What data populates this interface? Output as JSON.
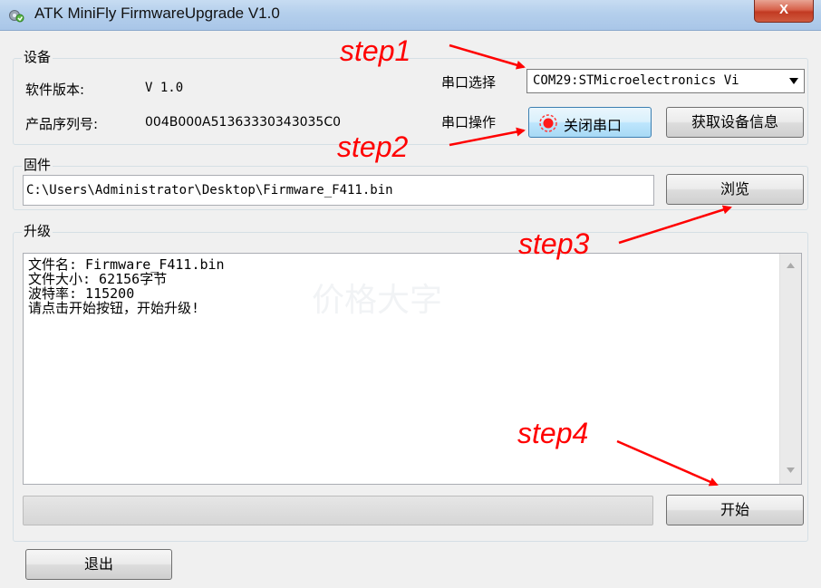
{
  "window": {
    "title": "ATK MiniFly FirmwareUpgrade V1.0",
    "close_label": "X",
    "titlebar_color": "#b4cfec",
    "close_color": "#c23a22"
  },
  "device": {
    "group_label": "设备",
    "sw_version_label": "软件版本:",
    "sw_version_value": "V 1.0",
    "serial_label": "产品序列号:",
    "serial_value": "004B000A51363330343035C0",
    "port_select_label": "串口选择",
    "port_select_value": "COM29:STMicroelectronics Vi",
    "port_op_label": "串口操作",
    "close_port_button": "关闭串口",
    "get_info_button": "获取设备信息"
  },
  "firmware": {
    "group_label": "固件",
    "path": "C:\\Users\\Administrator\\Desktop\\Firmware_F411.bin",
    "browse_button": "浏览"
  },
  "upgrade": {
    "group_label": "升级",
    "log": [
      "文件名: Firmware_F411.bin",
      "文件大小: 62156字节",
      "波特率: 115200",
      "请点击开始按钮，开始升级!"
    ],
    "watermark": "价格大字",
    "progress": 0,
    "start_button": "开始"
  },
  "exit_button": "退出",
  "annotations": {
    "color": "#ff0000",
    "step1": "step1",
    "step2": "step2",
    "step3": "step3",
    "step4": "step4"
  }
}
